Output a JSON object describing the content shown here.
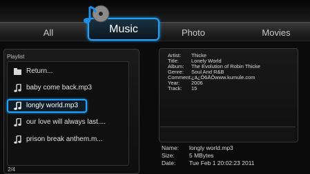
{
  "tabs": {
    "all": "All",
    "music": "Music",
    "photo": "Photo",
    "movies": "Movies"
  },
  "playlist": {
    "header": "Playlist",
    "items": [
      {
        "label": "Return...",
        "icon": "folder-icon"
      },
      {
        "label": "baby come back.mp3",
        "icon": "music-note-icon"
      },
      {
        "label": "longly world.mp3",
        "icon": "music-note-icon"
      },
      {
        "label": "our love will always last....",
        "icon": "music-note-icon"
      },
      {
        "label": "prison break anthem.m...",
        "icon": "music-note-icon"
      }
    ],
    "selected_index": 2,
    "count": "2/4"
  },
  "info": {
    "artist_key": "Artist:",
    "artist": "Thicke",
    "title_key": "Title:",
    "title": "Lonely World",
    "album_key": "Album:",
    "album": "The Evolution of Robin Thicke",
    "genre_key": "Genre:",
    "genre": "Soul And R&B",
    "comment_key": "Comment:",
    "comment": "¿ä¿Ó6ÄÒwww.kumule.com",
    "year_key": "Year:",
    "year": "2006",
    "track_key": "Track:",
    "track": "15"
  },
  "file": {
    "name_key": "Name:",
    "name": "longly world.mp3",
    "size_key": "Size:",
    "size": "5 MBytes",
    "date_key": "Date:",
    "date": "Tue Feb  1 20:02:23 2011"
  },
  "colors": {
    "accent": "#1fa3ff",
    "background": "#0b0b0b"
  }
}
